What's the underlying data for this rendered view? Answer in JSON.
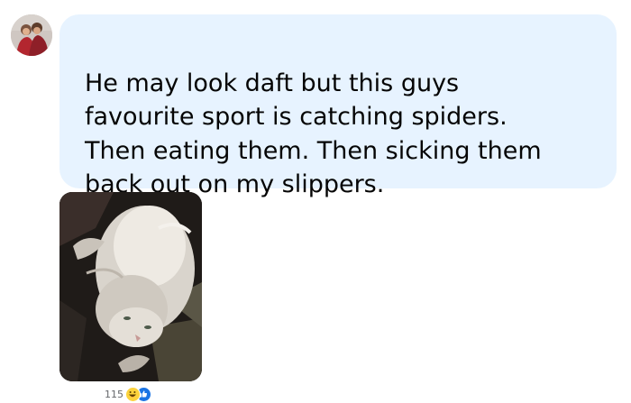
{
  "comment": {
    "author_avatar": "user-avatar-photo",
    "text": "He may look daft but this guys\nfavourite sport is catching spiders.\nThen eating them. Then sicking them\nback out on my slippers.",
    "bubble_color": "#e7f3ff",
    "text_color": "#050505"
  },
  "attachment": {
    "image": "cat-photo"
  },
  "reactions": {
    "count": "115",
    "types": [
      "haha-icon",
      "like-icon"
    ],
    "like_color": "#1b74e4",
    "haha_color": "#fcd23c"
  }
}
